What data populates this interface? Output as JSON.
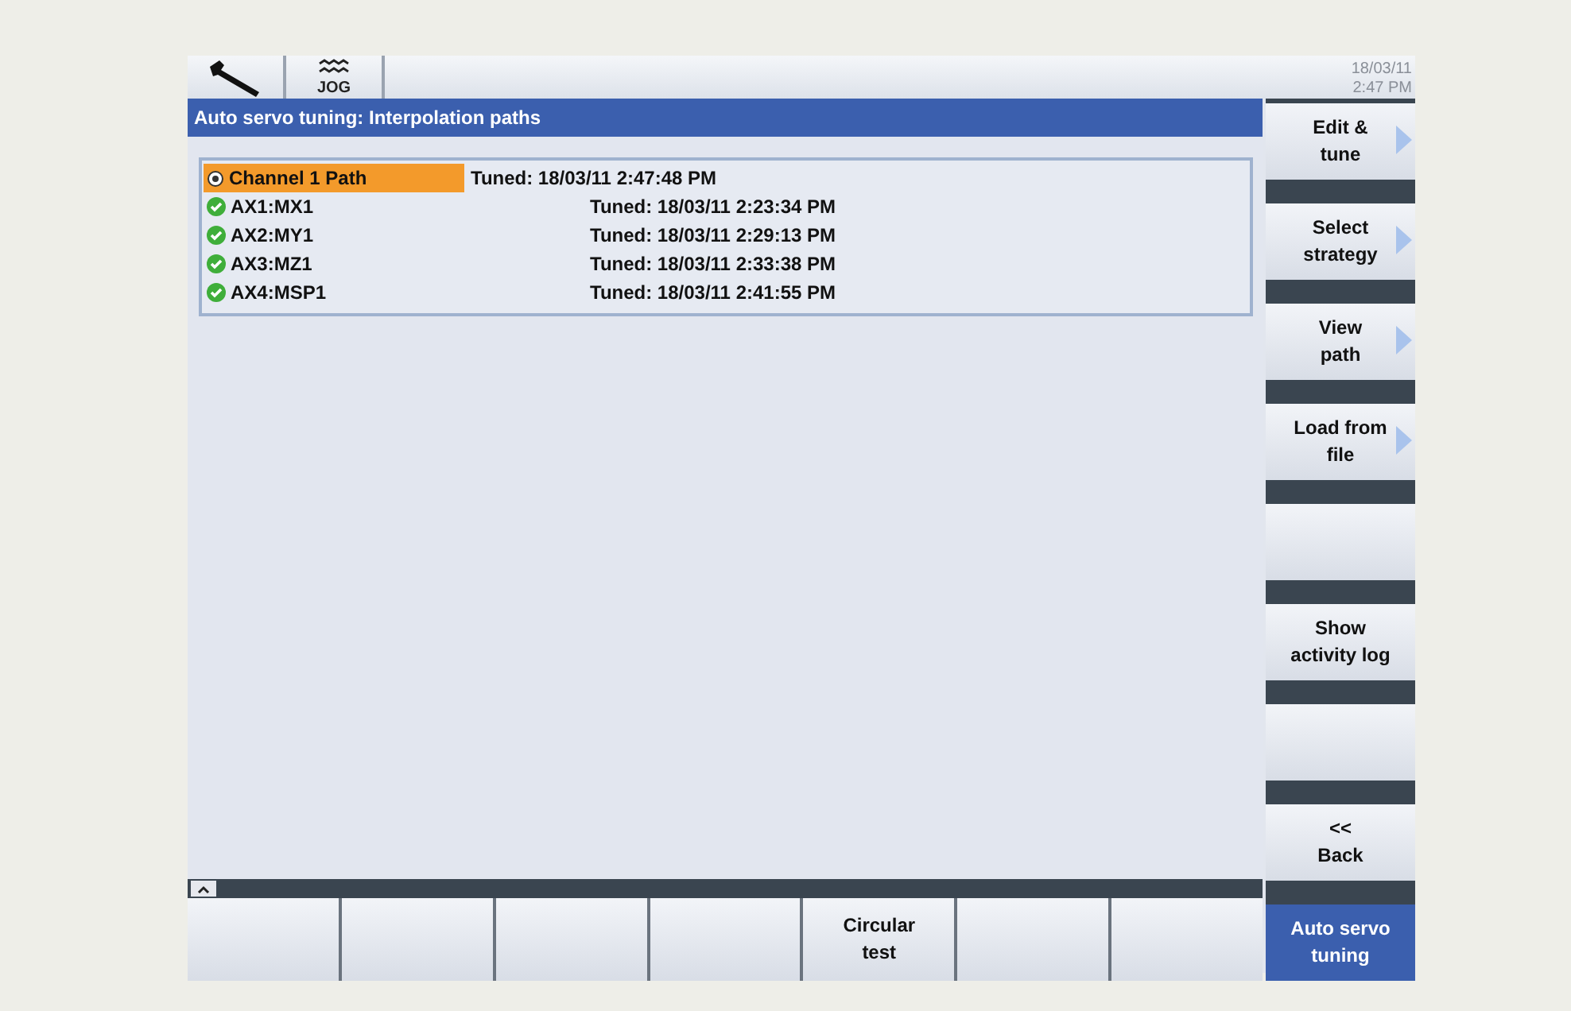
{
  "header": {
    "mode_label": "JOG",
    "date": "18/03/11",
    "time": "2:47 PM"
  },
  "title": "Auto servo tuning: Interpolation paths",
  "rows": [
    {
      "kind": "channel",
      "name": "Channel 1 Path",
      "tuned": "Tuned: 18/03/11 2:47:48 PM",
      "selected": true
    },
    {
      "kind": "axis",
      "name": "AX1:MX1",
      "tuned": "Tuned: 18/03/11 2:23:34 PM",
      "selected": false
    },
    {
      "kind": "axis",
      "name": "AX2:MY1",
      "tuned": "Tuned: 18/03/11 2:29:13 PM",
      "selected": false
    },
    {
      "kind": "axis",
      "name": "AX3:MZ1",
      "tuned": "Tuned: 18/03/11 2:33:38 PM",
      "selected": false
    },
    {
      "kind": "axis",
      "name": "AX4:MSP1",
      "tuned": "Tuned: 18/03/11 2:41:55 PM",
      "selected": false
    }
  ],
  "vertical_softkeys": [
    {
      "label": "Edit &\ntune",
      "arrow": true,
      "selected": false
    },
    {
      "label": "Select\nstrategy",
      "arrow": true,
      "selected": false
    },
    {
      "label": "View\npath",
      "arrow": true,
      "selected": false
    },
    {
      "label": "Load from\nfile",
      "arrow": true,
      "selected": false
    },
    {
      "arrow": false,
      "selected": false
    },
    {
      "label": "Show\nactivity log",
      "arrow": false,
      "selected": false
    },
    {
      "arrow": false,
      "selected": false
    },
    {
      "label": "<<\nBack",
      "arrow": false,
      "selected": false
    },
    {
      "label": "Auto servo\ntuning",
      "arrow": false,
      "selected": true
    }
  ],
  "horizontal_softkeys": [
    {
      "selected": false
    },
    {
      "selected": false
    },
    {
      "selected": false
    },
    {
      "selected": false
    },
    {
      "label": "Circular\ntest",
      "selected": false
    },
    {
      "selected": false
    },
    {
      "selected": false
    }
  ]
}
